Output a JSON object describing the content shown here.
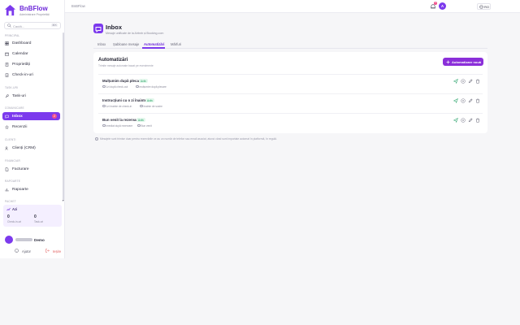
{
  "brand": {
    "name": "BnBFlow",
    "tagline": "Administrare Proprietăți"
  },
  "search": {
    "placeholder": "Caută...",
    "shortcut": "⌘K"
  },
  "sidebar": {
    "sections": {
      "principal": "Principal",
      "task": "Task-uri",
      "comm": "Comunicare",
      "clients": "Clienți",
      "finance": "Financiar",
      "reports": "Rapoarte",
      "activity": "Pachet"
    },
    "items": [
      {
        "label": "Dashboard"
      },
      {
        "label": "Calendar"
      },
      {
        "label": "Proprietăți"
      },
      {
        "label": "Check-in-uri"
      },
      {
        "label": "Task-uri"
      },
      {
        "label": "Inbox",
        "badge": "2"
      },
      {
        "label": "Recenzii"
      },
      {
        "label": "Clienți (CRM)"
      },
      {
        "label": "Facturare"
      },
      {
        "label": "Rapoarte"
      }
    ],
    "activity": {
      "title": "Azi",
      "stat1_value": "0",
      "stat1_label": "Check-in-uri",
      "stat2_value": "0",
      "stat2_label": "Task-uri"
    },
    "user": {
      "name": "Demo"
    },
    "footer": {
      "help": "Ajutor",
      "logout": "Ieșire"
    }
  },
  "topbar": {
    "breadcrumb": "BnBFlow",
    "lang": "RO",
    "notif_count": "3",
    "avatar": "A"
  },
  "page": {
    "title": "Inbox",
    "subtitle": "Mesaje unificate de la Airbnb și Booking.com"
  },
  "tabs": [
    {
      "label": "Inbox"
    },
    {
      "label": "Șabloane mesaje"
    },
    {
      "label": "Automatizări"
    },
    {
      "label": "Mărfuri"
    }
  ],
  "card": {
    "title": "Automatizări",
    "subtitle": "Trimite mesaje automate bazat pe evenimente",
    "new_button": "Automatizare nouă",
    "rows": [
      {
        "title": "Mulțumim după plecare",
        "status": "Activ",
        "meta1": "1zi după check-out",
        "meta2": "mulțumire după plecare"
      },
      {
        "title": "Instrucțiuni cu o zi înainte",
        "status": "Activ",
        "meta1": "1zi înainte de check-in",
        "meta2": "înainte de sosire"
      },
      {
        "title": "Bun venit la rezervare",
        "status": "Activ",
        "meta1": "imediat după rezervare",
        "meta2": "Bun venit"
      }
    ]
  },
  "info_note": "Mesajele sunt trimise doar pentru rezervările ce au un număr de telefon sau email asociat, atunci când sunt importate automat în platformă, în regulă."
}
